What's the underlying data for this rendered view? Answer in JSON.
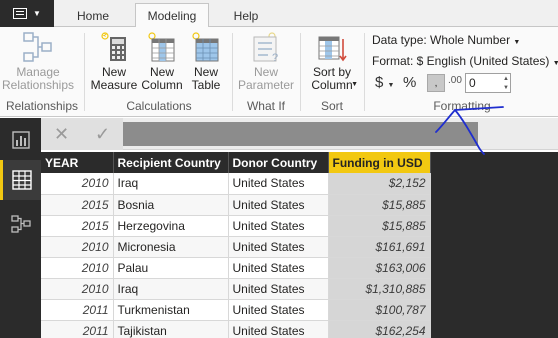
{
  "tabs": {
    "home": "Home",
    "modeling": "Modeling",
    "help": "Help"
  },
  "ribbon": {
    "manage_relationships": "Manage Relationships",
    "new_measure": "New Measure",
    "new_column": "New Column",
    "new_table": "New Table",
    "new_parameter": "New Parameter",
    "sort_by_column": "Sort by Column",
    "groups": {
      "relationships": "Relationships",
      "calculations": "Calculations",
      "what_if": "What If",
      "sort": "Sort",
      "formatting": "Formatting"
    },
    "formatting": {
      "data_type": "Data type: Whole Number",
      "format": "Format: $ English (United States)",
      "currency_symbol": "$",
      "percent_symbol": "%",
      "comma_symbol": ",",
      "decimal_symbol": ".00",
      "decimal_places": "0"
    }
  },
  "formula_bar": {
    "cancel": "✕",
    "commit": "✓"
  },
  "table": {
    "columns": [
      "YEAR",
      "Recipient Country",
      "Donor Country",
      "Funding in USD"
    ],
    "rows": [
      [
        "2010",
        "Iraq",
        "United States",
        "$2,152"
      ],
      [
        "2015",
        "Bosnia",
        "United States",
        "$15,885"
      ],
      [
        "2015",
        "Herzegovina",
        "United States",
        "$15,885"
      ],
      [
        "2010",
        "Micronesia",
        "United States",
        "$161,691"
      ],
      [
        "2010",
        "Palau",
        "United States",
        "$163,006"
      ],
      [
        "2010",
        "Iraq",
        "United States",
        "$1,310,885"
      ],
      [
        "2011",
        "Turkmenistan",
        "United States",
        "$100,787"
      ],
      [
        "2011",
        "Tajikistan",
        "United States",
        "$162,254"
      ]
    ]
  },
  "colors": {
    "accent": "#f2c811",
    "dark": "#2b2b2b",
    "annotation": "#1f2ecf"
  }
}
